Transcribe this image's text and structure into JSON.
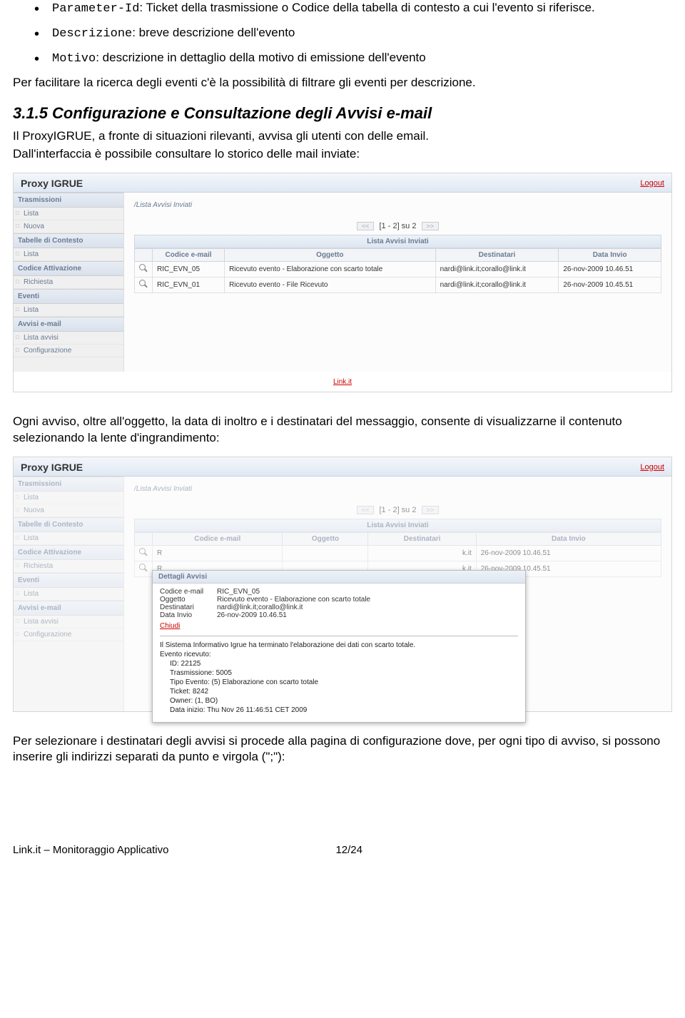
{
  "bullets": {
    "b1_code": "Parameter-Id",
    "b1_text": ": Ticket della trasmissione o Codice della tabella di contesto a cui l'evento si riferisce.",
    "b2_code": "Descrizione",
    "b2_text": ": breve descrizione dell'evento",
    "b3_code": "Motivo",
    "b3_text": ": descrizione in dettaglio della motivo di emissione dell'evento"
  },
  "para1": "Per facilitare la ricerca degli eventi c'è la possibilità di filtrare gli eventi per descrizione.",
  "heading": "3.1.5 Configurazione e Consultazione degli Avvisi e-mail",
  "para2a": "Il ProxyIGRUE, a fronte di situazioni rilevanti, avvisa gli utenti con delle email.",
  "para2b": "Dall'interfaccia è possibile consultare lo storico delle mail inviate:",
  "para3": "Ogni avviso, oltre all'oggetto, la data di inoltro e i destinatari del messaggio, consente di visualizzarne il contenuto selezionando la lente d'ingrandimento:",
  "para4": "Per selezionare i destinatari degli avvisi si procede alla pagina di configurazione dove, per ogni tipo di avviso, si possono inserire gli indirizzi separati da punto e virgola (\";\"):",
  "footer": {
    "left": "Link.it – Monitoraggio Applicativo",
    "right": "12/24"
  },
  "app": {
    "title": "Proxy IGRUE",
    "logout": "Logout",
    "breadcrumb": "/Lista Avvisi Inviati",
    "pager": "[1 - 2] su 2",
    "pager_prev": "<<",
    "pager_next": ">>",
    "listtitle": "Lista Avvisi Inviati",
    "linkit": "Link.it",
    "sidebar": {
      "g1": "Trasmissioni",
      "g1i1": "Lista",
      "g1i2": "Nuova",
      "g2": "Tabelle di Contesto",
      "g2i1": "Lista",
      "g3": "Codice Attivazione",
      "g3i1": "Richiesta",
      "g4": "Eventi",
      "g4i1": "Lista",
      "g5": "Avvisi e-mail",
      "g5i1": "Lista avvisi",
      "g5i2": "Configurazione"
    },
    "cols": {
      "c0": "",
      "c1": "Codice e-mail",
      "c2": "Oggetto",
      "c3": "Destinatari",
      "c4": "Data Invio"
    },
    "rows": [
      {
        "code": "RIC_EVN_05",
        "ogg": "Ricevuto evento - Elaborazione con scarto totale",
        "dest": "nardi@link.it;corallo@link.it",
        "data": "26-nov-2009 10.46.51"
      },
      {
        "code": "RIC_EVN_01",
        "ogg": "Ricevuto evento - File Ricevuto",
        "dest": "nardi@link.it;corallo@link.it",
        "data": "26-nov-2009 10.45.51"
      }
    ]
  },
  "modal": {
    "title": "Dettagli Avvisi",
    "f1l": "Codice e-mail",
    "f1v": "RIC_EVN_05",
    "f2l": "Oggetto",
    "f2v": "Ricevuto evento - Elaborazione con scarto totale",
    "f3l": "Destinatari",
    "f3v": "nardi@link.it;corallo@link.it",
    "f4l": "Data Invio",
    "f4v": "26-nov-2009 10.46.51",
    "chiudi": "Chiudi",
    "body1": "Il Sistema Informativo Igrue ha terminato l'elaborazione dei dati con scarto totale.",
    "body2": "Evento ricevuto:",
    "body3": "ID: 22125",
    "body4": "Trasmissione: 5005",
    "body5": "Tipo Evento: (5) Elaborazione con scarto totale",
    "body6": "Ticket: 8242",
    "body7": "Owner: (1, BO)",
    "body8": "Data inizio: Thu Nov 26 11:46:51 CET 2009"
  }
}
